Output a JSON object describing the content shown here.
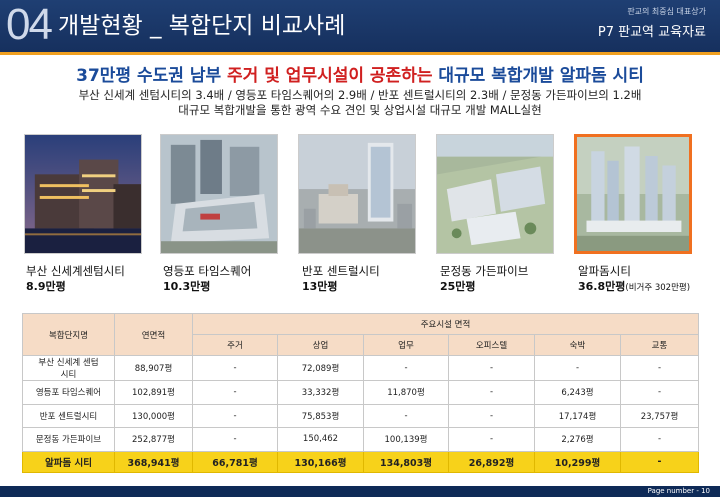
{
  "header": {
    "section_number": "04",
    "title": "개발현황 _ 복합단지 비교사례",
    "subtitle": "판교의 최중심 대표상가",
    "course": "P7 판교역 교육자료"
  },
  "headline": {
    "part1": "37만평 수도권 남부 ",
    "highlight": "주거 및 업무시설이 공존하는",
    "part2": " 대규모 복합개발 알파돔 시티"
  },
  "description": {
    "line1": "부산 신세계 센텀시티의 3.4배 / 영등포 타임스퀘어의 2.9배 / 반포 센트럴시티의 2.3배 / 문정동 가든파이브의 1.2배",
    "line2": "대규모 복합개발을 통한 광역 수요 견인 및 상업시설 대규모 개발 MALL실현"
  },
  "projects": [
    {
      "name": "부산 신세계센텀시티",
      "area": "8.9만평",
      "note": ""
    },
    {
      "name": "영등포 타임스퀘어",
      "area": "10.3만평",
      "note": ""
    },
    {
      "name": "반포 센트럴시티",
      "area": "13만평",
      "note": ""
    },
    {
      "name": "문정동 가든파이브",
      "area": "25만평",
      "note": ""
    },
    {
      "name": "알파돔시티",
      "area": "36.8만평",
      "note": "(비거주 302만평)"
    }
  ],
  "table": {
    "col_complex": "복합단지명",
    "col_total": "연면적",
    "col_group": "주요시설 면적",
    "sub_headers": [
      "주거",
      "상업",
      "업무",
      "오피스텔",
      "숙박",
      "교통"
    ],
    "rows": [
      [
        "부산 신세계 센텀\n시티",
        "88,907평",
        "-",
        "72,089평",
        "-",
        "-",
        "-",
        "-"
      ],
      [
        "영등포 타임스퀘어",
        "102,891평",
        "-",
        "33,332평",
        "11,870평",
        "-",
        "6,243평",
        "-"
      ],
      [
        "반포 센트럴시티",
        "130,000평",
        "-",
        "75,853평",
        "-",
        "-",
        "17,174평",
        "23,757평"
      ],
      [
        "문정동 가든파이브",
        "252,877평",
        "-",
        "150,462",
        "100,139평",
        "-",
        "2,276평",
        "-"
      ]
    ],
    "highlight_row": [
      "알파돔 시티",
      "368,941평",
      "66,781평",
      "130,166평",
      "134,803평",
      "26,892평",
      "10,299평",
      "-"
    ]
  },
  "footer": {
    "page_number": "Page number - 10"
  },
  "colors": {
    "header_bg": "#1f3f73",
    "accent_orange": "#f0a020",
    "headline_blue": "#1b4b9a",
    "highlight_red": "#d02020",
    "table_header": "#f6dcc6",
    "table_highlight": "#f7d21a"
  }
}
